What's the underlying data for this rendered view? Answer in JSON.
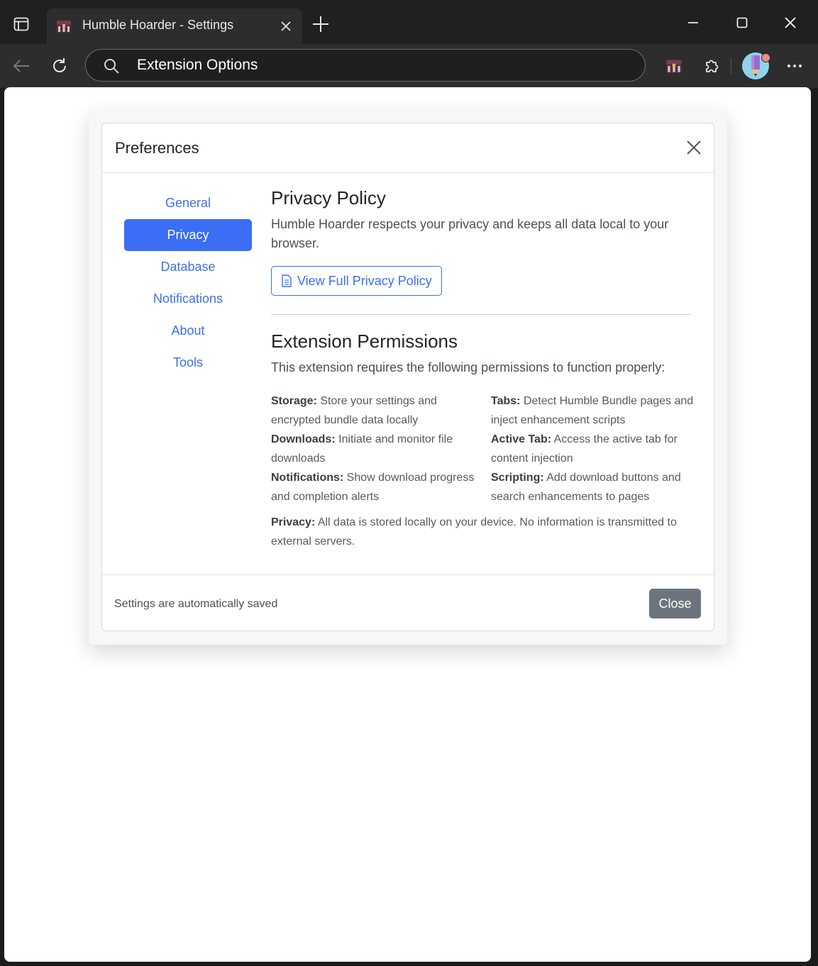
{
  "browser": {
    "tab_title": "Humble Hoarder - Settings",
    "address_text": "Extension Options"
  },
  "modal": {
    "title": "Preferences",
    "nav": [
      {
        "label": "General",
        "active": false
      },
      {
        "label": "Privacy",
        "active": true
      },
      {
        "label": "Database",
        "active": false
      },
      {
        "label": "Notifications",
        "active": false
      },
      {
        "label": "About",
        "active": false
      },
      {
        "label": "Tools",
        "active": false
      }
    ],
    "privacy": {
      "heading": "Privacy Policy",
      "description": "Humble Hoarder respects your privacy and keeps all data local to your browser.",
      "view_button": "View Full Privacy Policy"
    },
    "permissions": {
      "heading": "Extension Permissions",
      "intro": "This extension requires the following permissions to function properly:",
      "items": [
        {
          "name": "Storage:",
          "desc": " Store your settings and encrypted bundle data locally"
        },
        {
          "name": "Tabs:",
          "desc": " Detect Humble Bundle pages and inject enhancement scripts"
        },
        {
          "name": "Downloads:",
          "desc": " Initiate and monitor file downloads"
        },
        {
          "name": "Active Tab:",
          "desc": " Access the active tab for content injection"
        },
        {
          "name": "Notifications:",
          "desc": " Show download progress and completion alerts"
        },
        {
          "name": "Scripting:",
          "desc": " Add download buttons and search enhancements to pages"
        }
      ],
      "privacy_label": "Privacy:",
      "privacy_text": " All data is stored locally on your device. No information is transmitted to external servers."
    },
    "footer": {
      "note": "Settings are automatically saved",
      "close_label": "Close"
    }
  },
  "colors": {
    "accent": "#3b6ef5",
    "link": "#3b71e4",
    "secondary_button": "#6c757d"
  }
}
